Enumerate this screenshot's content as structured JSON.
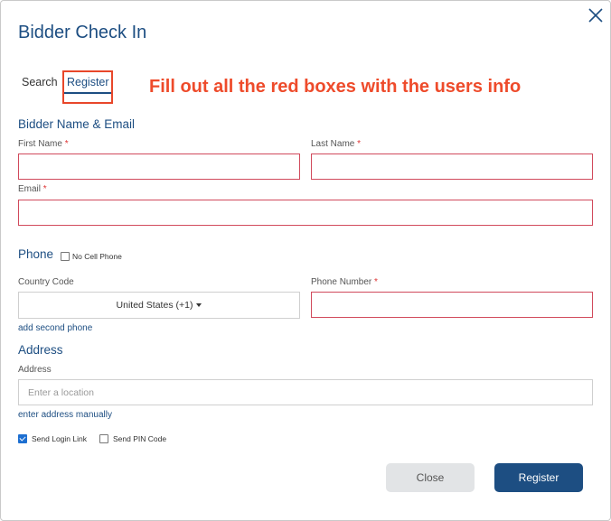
{
  "modal": {
    "title": "Bidder Check In"
  },
  "tabs": {
    "search": "Search",
    "register": "Register"
  },
  "annotation": "Fill out all the red boxes with the users info",
  "name_section": {
    "heading": "Bidder Name & Email",
    "first_name_label": "First Name",
    "last_name_label": "Last Name",
    "email_label": "Email",
    "required_mark": "*"
  },
  "phone_section": {
    "heading": "Phone",
    "no_cell_label": "No Cell Phone",
    "no_cell_checked": false,
    "country_code_label": "Country Code",
    "country_code_value": "United States (+1)",
    "phone_number_label": "Phone Number",
    "add_second_phone": "add second phone"
  },
  "address_section": {
    "heading": "Address",
    "address_label": "Address",
    "address_placeholder": "Enter a location",
    "enter_manually": "enter address manually"
  },
  "options": {
    "send_login_link": "Send Login Link",
    "send_login_link_checked": true,
    "send_pin_code": "Send PIN Code",
    "send_pin_code_checked": false
  },
  "buttons": {
    "close": "Close",
    "register": "Register"
  },
  "colors": {
    "brand": "#1d4e82",
    "annotation": "#ee4b2b",
    "required_border": "#d14a5c"
  }
}
